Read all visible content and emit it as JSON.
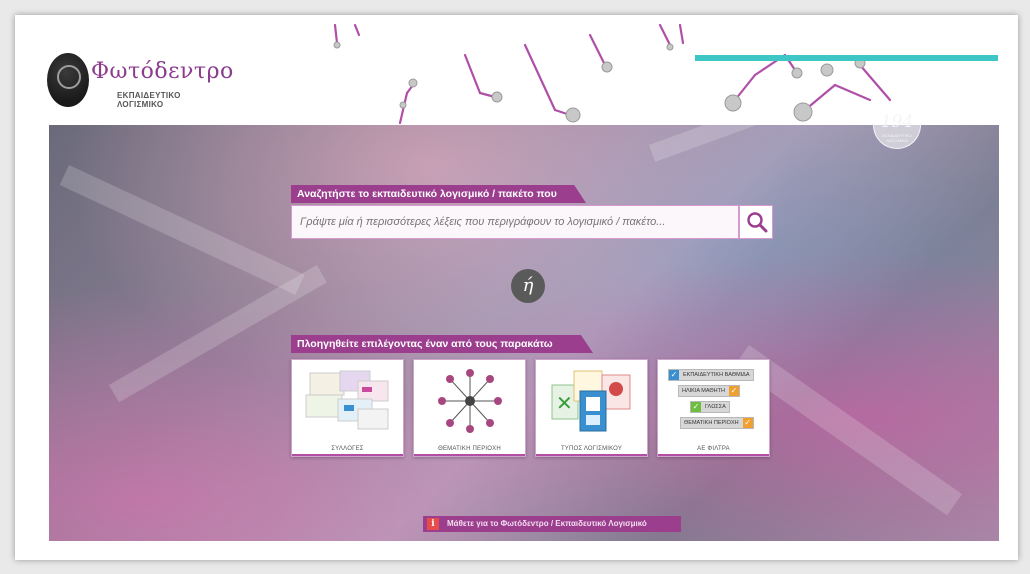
{
  "header": {
    "logo_title": "Φωτόδεντρο",
    "logo_subtitle": "ΕΚΠΑΙΔΕΥΤΙΚΟ ΛΟΓΙΣΜΙΚΟ",
    "counter_value": "194",
    "counter_caption": "ΕΚΠΑΙΔΕΥΤΙΚΟ ΛΟΓΙΣΜΙΚΟ"
  },
  "search": {
    "label": "Αναζητήστε το εκπαιδευτικό λογισμικό / πακέτο που επιθυμείτε:",
    "placeholder": "Γράψτε μία ή περισσότερες λέξεις που περιγράφουν το λογισμικό / πακέτο...",
    "button_icon": "search-icon"
  },
  "or_text": "ή",
  "navigate": {
    "label": "Πλοηγηθείτε επιλέγοντας έναν από τους παρακάτω τρόπους:",
    "cards": [
      {
        "label": "ΣΥΛΛΟΓΕΣ"
      },
      {
        "label": "ΘΕΜΑΤΙΚΗ ΠΕΡΙΟΧΗ"
      },
      {
        "label": "ΤΥΠΟΣ ΛΟΓΙΣΜΙΚΟΥ"
      },
      {
        "label": "ΑΕ ΦΙΛΤΡΑ"
      }
    ],
    "filters": [
      {
        "label": "ΕΚΠΑΙΔΕΥΤΙΚΗ ΒΑΘΜΙΔΑ",
        "check_color": "#3a8fd0"
      },
      {
        "label": "ΗΛΙΚΙΑ ΜΑΘΗΤΗ",
        "check_color": "#f0a030"
      },
      {
        "label": "ΓΛΩΣΣΑ",
        "check_color": "#6dbd3e"
      },
      {
        "label": "ΘΕΜΑΤΙΚΗ ΠΕΡΙΟΧΗ",
        "check_color": "#f0a030"
      }
    ]
  },
  "info": {
    "icon": "info-icon",
    "icon_glyph": "i",
    "text": "Μάθετε για το Φωτόδεντρο / Εκπαιδευτικό Λογισμικό"
  },
  "colors": {
    "accent_purple": "#9b3e8e",
    "teal": "#3ec6c6",
    "logo_purple": "#8b3c8f"
  }
}
